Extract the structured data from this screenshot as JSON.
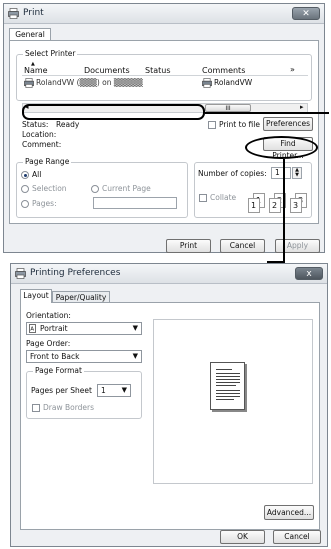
{
  "print_dialog": {
    "title": "Print",
    "tab": "General",
    "select_printer_label": "Select Printer",
    "columns": [
      "Name",
      "Documents",
      "Status",
      "Comments"
    ],
    "more_columns": "»",
    "printer_row": {
      "name": "RolandVW (▒▒▒) on ▒▒▒▒▒",
      "comment": "RolandVW"
    },
    "hscroll_thumb": "III",
    "status_label": "Status:",
    "status_value": "Ready",
    "location_label": "Location:",
    "comment_label": "Comment:",
    "print_to_file": "Print to file",
    "preferences_button": "Preferences",
    "find_printer_button": "Find Printer...",
    "page_range": {
      "title": "Page Range",
      "all": "All",
      "selection": "Selection",
      "current_page": "Current Page",
      "pages": "Pages:"
    },
    "copies_label": "Number of copies:",
    "copies_value": "1",
    "collate": "Collate",
    "collate_pages": [
      "1",
      "1",
      "2",
      "2",
      "3",
      "3"
    ],
    "buttons": {
      "print": "Print",
      "cancel": "Cancel",
      "apply": "Apply"
    }
  },
  "prefs_dialog": {
    "title": "Printing Preferences",
    "close": "x",
    "tabs": [
      "Layout",
      "Paper/Quality"
    ],
    "orientation_label": "Orientation:",
    "orientation_value": "Portrait",
    "page_order_label": "Page Order:",
    "page_order_value": "Front to Back",
    "page_format_title": "Page Format",
    "pages_per_sheet_label": "Pages per Sheet",
    "pages_per_sheet_value": "1",
    "draw_borders": "Draw Borders",
    "advanced_button": "Advanced...",
    "ok_button": "OK",
    "cancel_button": "Cancel"
  },
  "colors": {
    "highlight": "#000000",
    "window_bg": "#eef0f3"
  }
}
